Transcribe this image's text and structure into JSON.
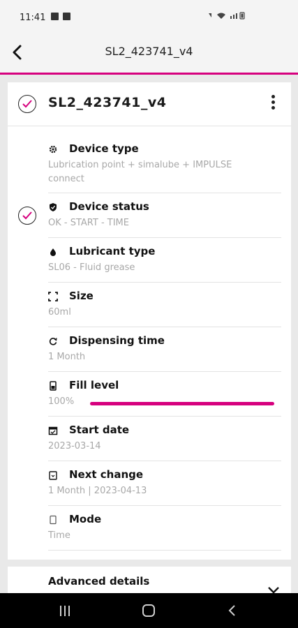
{
  "status_bar": {
    "time": "11:41"
  },
  "app_bar": {
    "title": "SL2_423741_v4"
  },
  "card": {
    "title": "SL2_423741_v4"
  },
  "details": {
    "device_type": {
      "label": "Device type",
      "value_line1": "Lubrication point + simalube + IMPULSE",
      "value_line2": "connect"
    },
    "device_status": {
      "label": "Device status",
      "value": "OK - START - TIME"
    },
    "lubricant_type": {
      "label": "Lubricant type",
      "value": "SL06 - Fluid grease"
    },
    "size": {
      "label": "Size",
      "value": "60ml"
    },
    "dispensing_time": {
      "label": "Dispensing time",
      "value": "1 Month"
    },
    "fill_level": {
      "label": "Fill level",
      "value": "100%",
      "fraction": 1.0
    },
    "start_date": {
      "label": "Start date",
      "value": "2023-03-14"
    },
    "next_change": {
      "label": "Next change",
      "value": "1 Month | 2023-04-13"
    },
    "mode": {
      "label": "Mode",
      "value": "Time"
    }
  },
  "advanced": {
    "label": "Advanced details"
  },
  "colors": {
    "accent": "#d6007e"
  },
  "icons": {
    "back": "back-arrow-icon",
    "check": "check-circle-icon",
    "menu": "kebab-menu-icon",
    "device_type": "gear-icon",
    "device_status": "shield-icon",
    "lubricant": "drop-icon",
    "size": "expand-icon",
    "dispensing": "refresh-icon",
    "fill": "battery-icon",
    "start": "calendar-icon",
    "next": "clipboard-icon",
    "mode": "mode-icon",
    "chevron": "chevron-down-icon"
  }
}
